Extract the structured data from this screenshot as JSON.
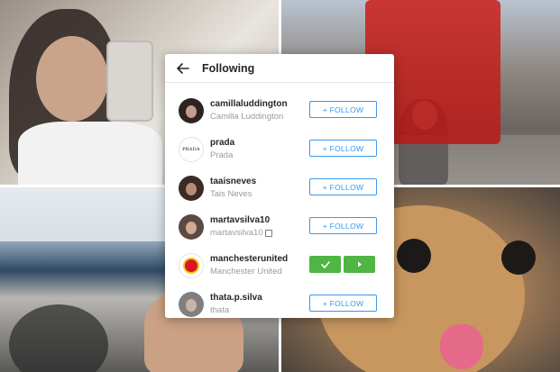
{
  "modal": {
    "title": "Following",
    "back_icon": "arrow-left-icon"
  },
  "users": [
    {
      "username": "camillaluddington",
      "fullname": "Camilla Luddington",
      "action": "+ FOLLOW",
      "avatar": "portrait"
    },
    {
      "username": "prada",
      "fullname": "Prada",
      "action": "+ FOLLOW",
      "avatar": "logo",
      "logo_text": "PRADA"
    },
    {
      "username": "taaisneves",
      "fullname": "Tais Neves",
      "action": "+ FOLLOW",
      "avatar": "portrait"
    },
    {
      "username": "martavsilva10",
      "fullname": "martavsilva10",
      "action": "+ FOLLOW",
      "avatar": "portrait"
    },
    {
      "username": "manchesterunited",
      "fullname": "Manchester United",
      "action": "pending",
      "avatar": "crest"
    },
    {
      "username": "thata.p.silva",
      "fullname": "thata",
      "action": "+ FOLLOW",
      "avatar": "portrait"
    }
  ],
  "colors": {
    "accent": "#3897f0",
    "confirm_green": "#4fb543"
  },
  "icons": {
    "check": "check-icon",
    "play": "play-icon"
  }
}
